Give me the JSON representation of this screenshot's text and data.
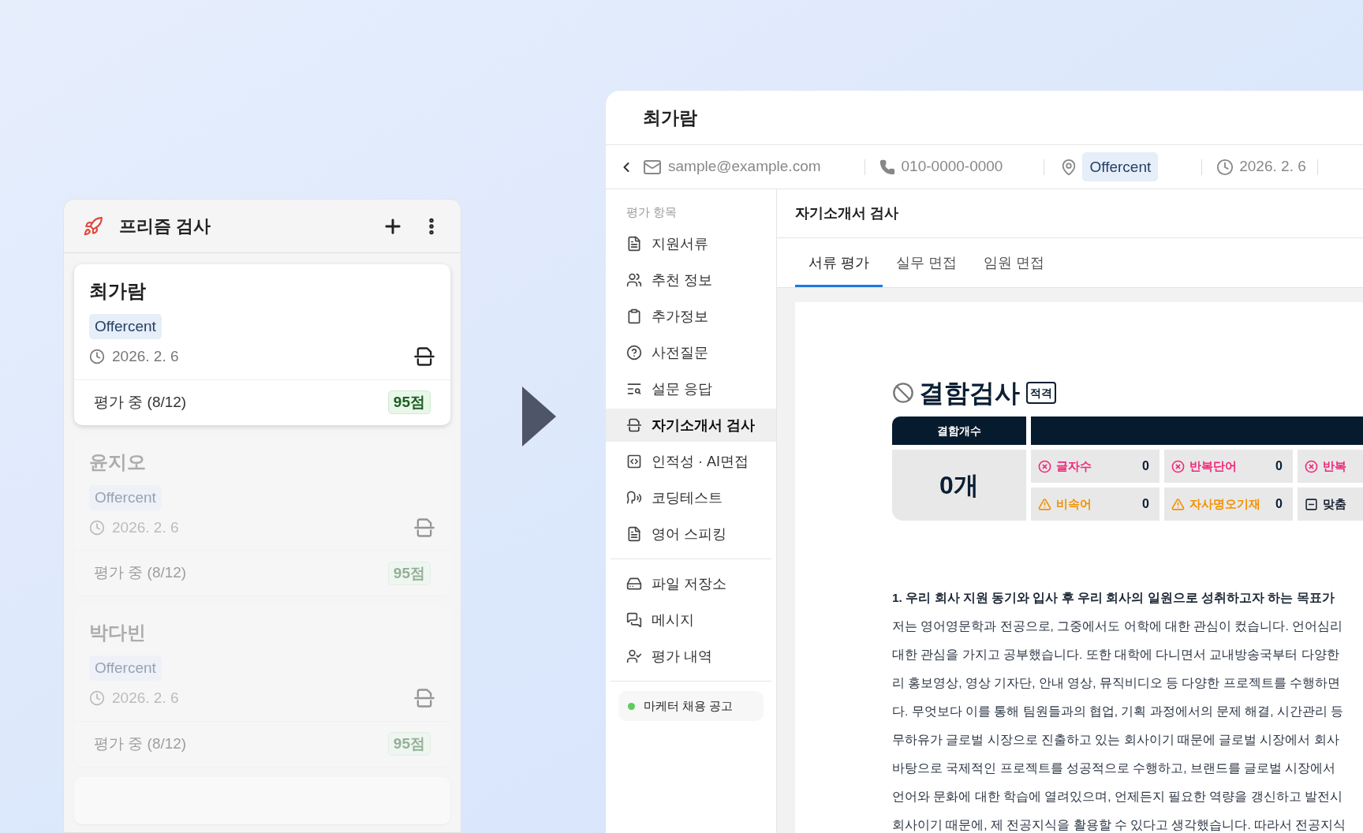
{
  "left_panel": {
    "title": "프리즘 검사",
    "cards": [
      {
        "name": "최가람",
        "company": "Offercent",
        "date": "2026. 2. 6",
        "status": "평가 중 (8/12)",
        "score": "95점",
        "selected": true
      },
      {
        "name": "윤지오",
        "company": "Offercent",
        "date": "2026. 2. 6",
        "status": "평가 중 (8/12)",
        "score": "95점",
        "selected": false
      },
      {
        "name": "박다빈",
        "company": "Offercent",
        "date": "2026. 2. 6",
        "status": "평가 중 (8/12)",
        "score": "95점",
        "selected": false
      }
    ]
  },
  "detail": {
    "name": "최가람",
    "email": "sample@example.com",
    "phone": "010-0000-0000",
    "company": "Offercent",
    "date": "2026. 2. 6",
    "sidebar": {
      "section_label": "평가 항목",
      "items": [
        {
          "label": "지원서류",
          "selected": false
        },
        {
          "label": "추천 정보",
          "selected": false
        },
        {
          "label": "추가정보",
          "selected": false
        },
        {
          "label": "사전질문",
          "selected": false
        },
        {
          "label": "설문 응답",
          "selected": false
        },
        {
          "label": "자기소개서 검사",
          "selected": true
        },
        {
          "label": "인적성 · AI면접",
          "selected": false
        },
        {
          "label": "코딩테스트",
          "selected": false
        },
        {
          "label": "영어 스피킹",
          "selected": false
        }
      ],
      "bottom_items": [
        {
          "label": "파일 저장소"
        },
        {
          "label": "메시지"
        },
        {
          "label": "평가 내역"
        }
      ],
      "job_posting": "마케터 채용 공고"
    },
    "content": {
      "title": "자기소개서 검사",
      "tabs": [
        {
          "label": "서류 평가",
          "selected": true
        },
        {
          "label": "실무 면접",
          "selected": false
        },
        {
          "label": "임원 면접",
          "selected": false
        }
      ],
      "defect_check": {
        "title": "결함검사",
        "badge": "적격",
        "count_header": "결함개수",
        "count": "0개",
        "cells": [
          {
            "kind": "error",
            "label": "글자수",
            "value": "0"
          },
          {
            "kind": "error",
            "label": "반복단어",
            "value": "0"
          },
          {
            "kind": "error",
            "label": "반복"
          },
          {
            "kind": "warning",
            "label": "비속어",
            "value": "0"
          },
          {
            "kind": "warning",
            "label": "자사명오기재",
            "value": "0"
          },
          {
            "kind": "neutral",
            "label": "맞춤"
          }
        ]
      },
      "essay": {
        "question": "1. 우리 회사 지원 동기와 입사 후 우리 회사의 일원으로 성취하고자 하는 목표가",
        "lines": [
          "저는 영어영문학과 전공으로, 그중에서도 어학에 대한 관심이 컸습니다. 언어심리",
          "대한 관심을 가지고 공부했습니다. 또한 대학에 다니면서 교내방송국부터 다양한",
          "리 홍보영상, 영상 기자단, 안내 영상, 뮤직비디오 등 다양한 프로젝트를 수행하면",
          "다. 무엇보다 이를 통해 팀원들과의 협업, 기획 과정에서의 문제 해결, 시간관리 등",
          "무하유가 글로벌 시장으로 진출하고 있는 회사이기 때문에 글로벌 시장에서 회사",
          "바탕으로 국제적인 프로젝트를 성공적으로 수행하고, 브랜드를 글로벌 시장에서",
          "언어와 문화에 대한 학습에 열려있으며, 언제든지 필요한 역량을 갱신하고 발전시",
          "회사이기 때문에, 제 전공지식을 활용할 수 있다고 생각했습니다. 따라서 전공지식"
        ]
      }
    }
  }
}
